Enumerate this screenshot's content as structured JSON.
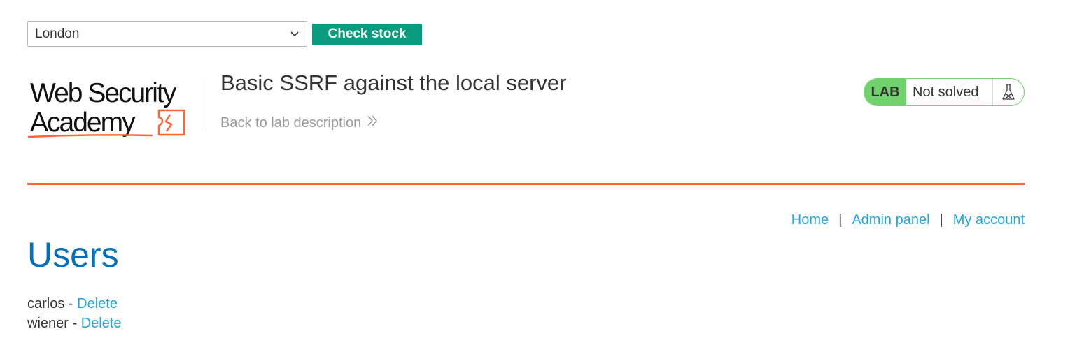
{
  "stock_check": {
    "selected_location": "London",
    "button_label": "Check stock"
  },
  "header": {
    "logo_text_line1": "Web Security",
    "logo_text_line2": "Academy",
    "lab_title": "Basic SSRF against the local server",
    "back_link": "Back to lab description",
    "lab_badge": "LAB",
    "lab_status": "Not solved"
  },
  "colors": {
    "accent_orange": "#ff6633",
    "button_green": "#0a9c7e",
    "lab_green": "#70d16d",
    "link_blue": "#1ea7e0",
    "heading_blue": "#0071bc"
  },
  "nav": {
    "home": "Home",
    "admin_panel": "Admin panel",
    "my_account": "My account",
    "separator": "|"
  },
  "main": {
    "heading": "Users",
    "users": [
      {
        "name": "carlos",
        "dash": "-",
        "action": "Delete"
      },
      {
        "name": "wiener",
        "dash": "-",
        "action": "Delete"
      }
    ]
  }
}
